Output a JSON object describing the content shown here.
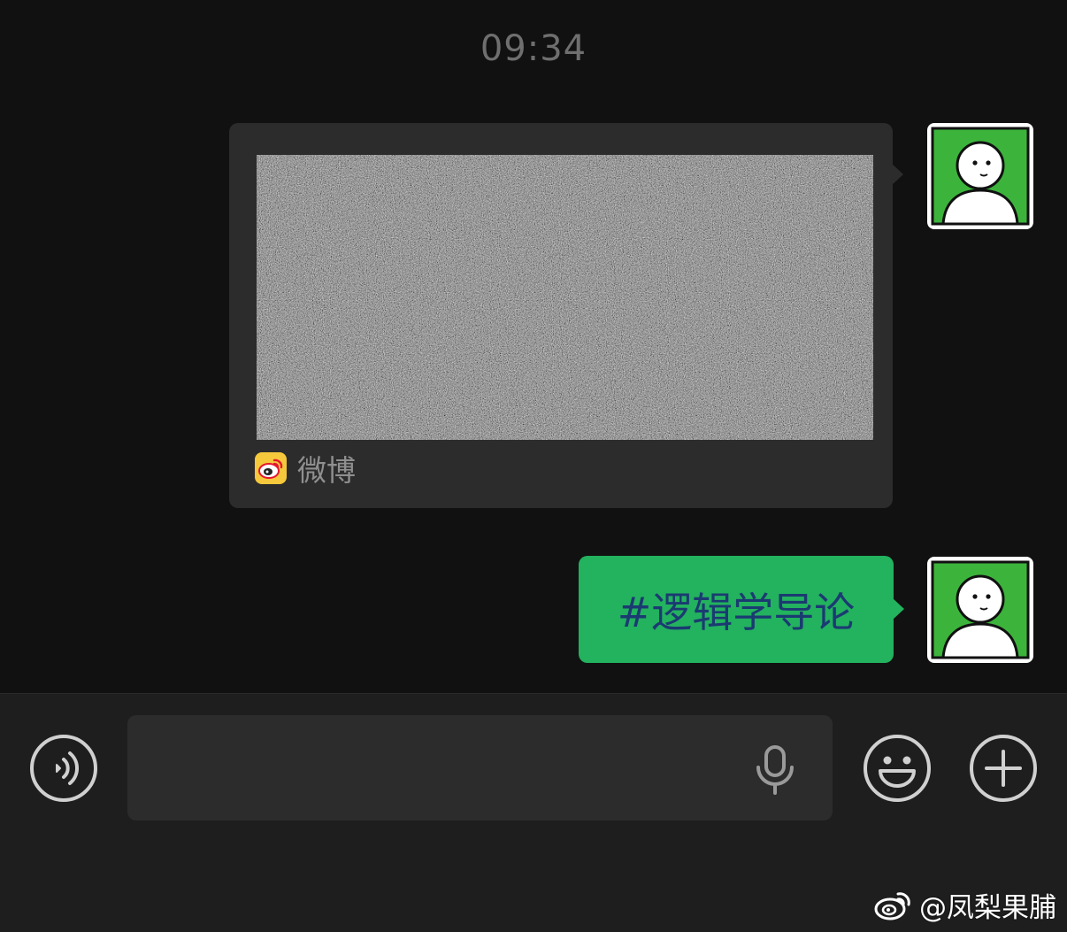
{
  "timestamp": "09:34",
  "messages": [
    {
      "type": "link-card",
      "source": {
        "icon": "weibo-logo-icon",
        "label": "微博"
      }
    },
    {
      "type": "text",
      "text": "#逻辑学导论"
    }
  ],
  "avatar": {
    "icon": "stick-figure-avatar",
    "background": "#3cb43c"
  },
  "input_bar": {
    "voice_icon": "voice-icon",
    "input_value": "",
    "mic_icon": "microphone-icon",
    "emoji_icon": "emoji-icon",
    "plus_icon": "plus-icon"
  },
  "watermark": {
    "text": "@凤梨果脯"
  },
  "colors": {
    "background": "#111111",
    "card": "#2c2c2c",
    "bubble_green": "#23b25e",
    "bubble_text": "#1b3a72",
    "bottom_bar": "#1e1e1e",
    "weibo_yellow": "#f6c83c"
  }
}
